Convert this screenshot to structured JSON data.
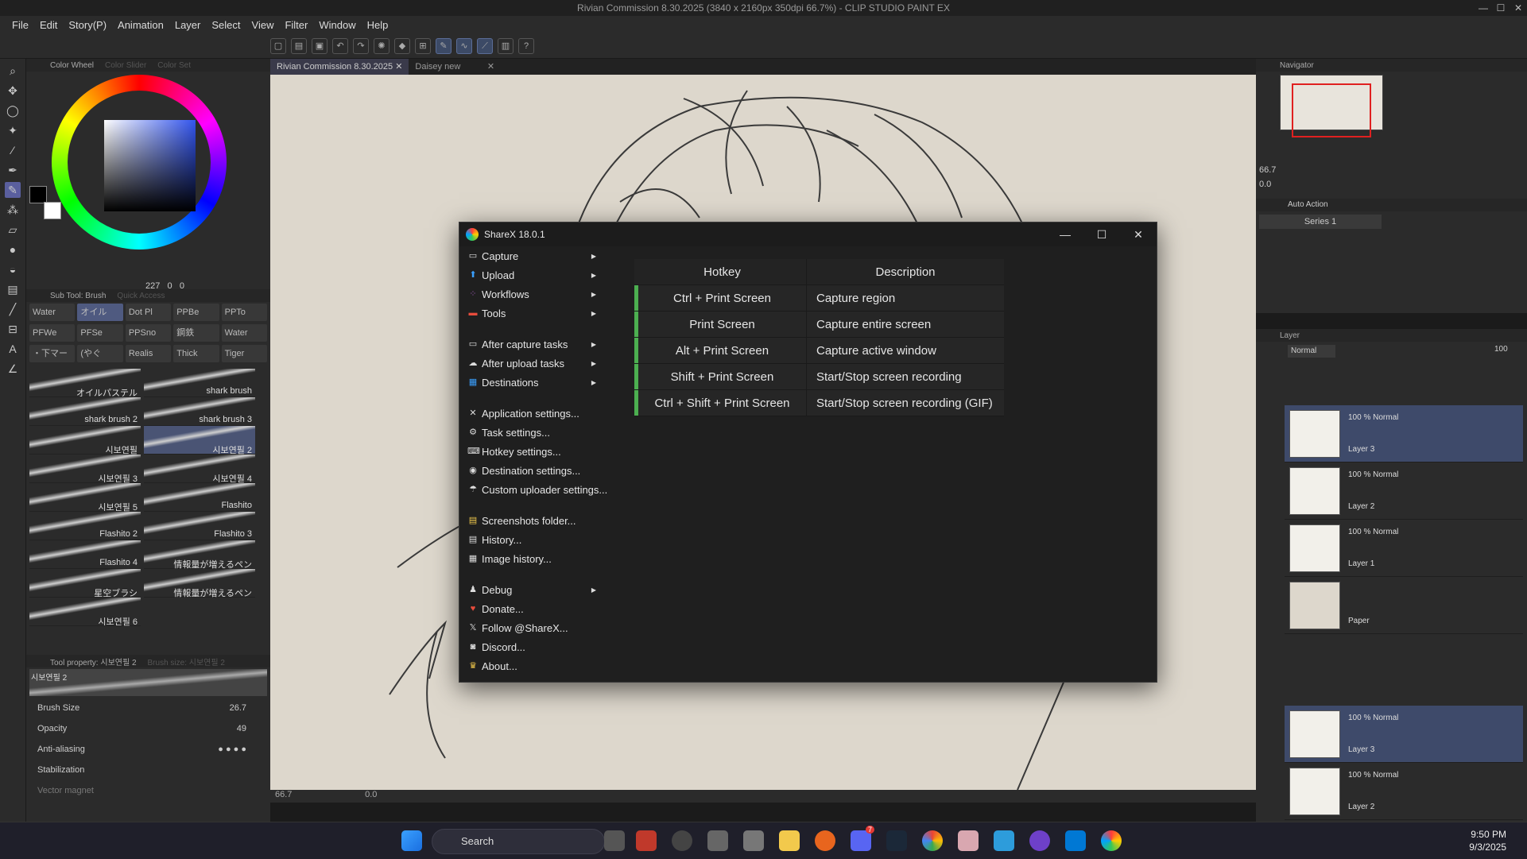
{
  "window_title": "Rivian Commission 8.30.2025 (3840 x 2160px 350dpi 66.7%)  - CLIP STUDIO PAINT EX",
  "menu": [
    "File",
    "Edit",
    "Story(P)",
    "Animation",
    "Layer",
    "Select",
    "View",
    "Filter",
    "Window",
    "Help"
  ],
  "color_panel": {
    "tabs": [
      "Color Wheel",
      "Color Slider",
      "Color Set"
    ],
    "h": "227",
    "s": "0",
    "v": "0"
  },
  "subtool": {
    "title": "Sub Tool: Brush",
    "quick_access": "Quick Access",
    "chips_row1": [
      "Water",
      "オイル",
      "Dot Pl",
      "PPBe",
      "PPTo"
    ],
    "chips_row2": [
      "PFWe",
      "PFSe",
      "PPSno",
      "鋼鉄",
      "Water"
    ],
    "chips_row3": [
      "・下マー",
      "(やぐ",
      "Realis",
      "Thick",
      "Tiger"
    ],
    "brushes": [
      "オイルパステル",
      "shark brush",
      "shark brush 2",
      "shark brush 3",
      "시보연필",
      "시보연필 2",
      "시보연필 3",
      "시보연필 4",
      "시보연필 5",
      "Flashito",
      "Flashito 2",
      "Flashito 3",
      "Flashito 4",
      "情報量が増えるペン",
      "星空ブラシ",
      "情報量が増えるペン",
      "시보연필 6",
      ""
    ]
  },
  "tool_property": {
    "title": "Tool property: 시보연필 2",
    "brush_label": "Brush size: 시보연필 2",
    "preview_label": "시보연필 2",
    "brush_size_label": "Brush Size",
    "brush_size": "26.7",
    "opacity_label": "Opacity",
    "opacity": "49",
    "antialias_label": "Anti-aliasing",
    "stabilization_label": "Stabilization",
    "vector_magnet_label": "Vector magnet"
  },
  "doc_tabs": [
    "Rivian Commission 8.30.2025",
    "Daisey new"
  ],
  "canvas_status": {
    "zoom": "66.7",
    "angle": "0.0"
  },
  "navigator": {
    "title": "Navigator",
    "zoom": "66.7",
    "angle": "0.0"
  },
  "auto_action": {
    "title": "Auto Action",
    "series": "Series 1"
  },
  "layer_panel": {
    "title": "Layer",
    "blend": "Normal",
    "opacity": "100",
    "layers": [
      {
        "name": "Layer 3",
        "blend": "100 % Normal"
      },
      {
        "name": "Layer 2",
        "blend": "100 % Normal"
      },
      {
        "name": "Layer 1",
        "blend": "100 % Normal"
      },
      {
        "name": "Paper",
        "blend": ""
      },
      {
        "name": "Layer 3",
        "blend": "100 % Normal"
      },
      {
        "name": "Layer 2",
        "blend": "100 % Normal"
      }
    ]
  },
  "sharex": {
    "title": "ShareX 18.0.1",
    "menu": [
      {
        "label": "Capture",
        "icon": "capture-icon",
        "submenu": true
      },
      {
        "label": "Upload",
        "icon": "upload-icon",
        "submenu": true
      },
      {
        "label": "Workflows",
        "icon": "workflows-icon",
        "submenu": true
      },
      {
        "label": "Tools",
        "icon": "tools-icon",
        "submenu": true
      },
      {
        "sep": true
      },
      {
        "label": "After capture tasks",
        "icon": "after-capture-icon",
        "submenu": true
      },
      {
        "label": "After upload tasks",
        "icon": "after-upload-icon",
        "submenu": true
      },
      {
        "label": "Destinations",
        "icon": "destinations-icon",
        "submenu": true
      },
      {
        "sep": true
      },
      {
        "label": "Application settings...",
        "icon": "app-settings-icon"
      },
      {
        "label": "Task settings...",
        "icon": "task-settings-icon"
      },
      {
        "label": "Hotkey settings...",
        "icon": "hotkey-settings-icon"
      },
      {
        "label": "Destination settings...",
        "icon": "destination-settings-icon"
      },
      {
        "label": "Custom uploader settings...",
        "icon": "custom-uploader-icon"
      },
      {
        "sep": true
      },
      {
        "label": "Screenshots folder...",
        "icon": "folder-icon"
      },
      {
        "label": "History...",
        "icon": "history-icon"
      },
      {
        "label": "Image history...",
        "icon": "image-history-icon"
      },
      {
        "sep": true
      },
      {
        "label": "Debug",
        "icon": "debug-icon",
        "submenu": true
      },
      {
        "label": "Donate...",
        "icon": "heart-icon"
      },
      {
        "label": "Follow @ShareX...",
        "icon": "x-icon"
      },
      {
        "label": "Discord...",
        "icon": "discord-icon"
      },
      {
        "label": "About...",
        "icon": "crown-icon"
      }
    ],
    "hotkey_header": "Hotkey",
    "description_header": "Description",
    "hotkeys": [
      {
        "key": "Ctrl + Print Screen",
        "desc": "Capture region"
      },
      {
        "key": "Print Screen",
        "desc": "Capture entire screen"
      },
      {
        "key": "Alt + Print Screen",
        "desc": "Capture active window"
      },
      {
        "key": "Shift + Print Screen",
        "desc": "Start/Stop screen recording"
      },
      {
        "key": "Ctrl + Shift + Print Screen",
        "desc": "Start/Stop screen recording (GIF)"
      }
    ]
  },
  "taskbar": {
    "search": "Search",
    "time": "9:50 PM",
    "date": "9/3/2025",
    "discord_badge": "7"
  }
}
